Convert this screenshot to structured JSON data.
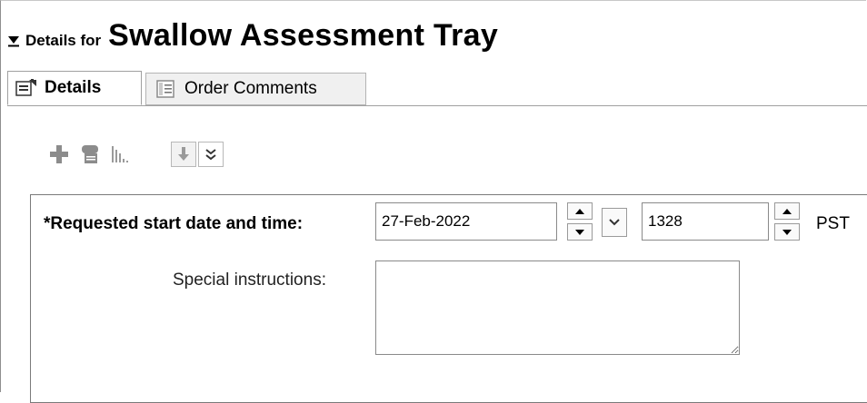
{
  "header": {
    "prefix": "Details for",
    "title": "Swallow Assessment Tray"
  },
  "tabs": [
    {
      "label": "Details",
      "icon": "details-tab-icon",
      "active": true
    },
    {
      "label": "Order Comments",
      "icon": "comments-tab-icon",
      "active": false
    }
  ],
  "toolbar": {
    "icons": [
      "add-icon",
      "link-icon",
      "chart-icon",
      "download-arrow-icon",
      "expand-chevron-icon"
    ]
  },
  "form": {
    "start_label": "*Requested start date and time:",
    "start_date": "27-Feb-2022",
    "start_time": "1328",
    "timezone": "PST",
    "special_label": "Special instructions:",
    "special_value": ""
  },
  "colors": {
    "disabled_icon": "#8c8c8c",
    "border": "#8a8a8a"
  }
}
